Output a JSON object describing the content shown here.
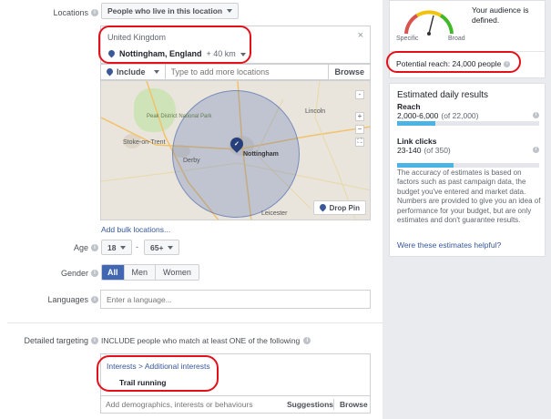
{
  "locations": {
    "label": "Locations",
    "type_dropdown": "People who live in this location",
    "country": "United Kingdom",
    "city": "Nottingham, England",
    "radius": "+ 40 km",
    "include_dropdown": "Include",
    "add_placeholder": "Type to add more locations",
    "browse_label": "Browse",
    "add_bulk_link": "Add bulk locations...",
    "map": {
      "place_labels": [
        "Peak District National Park",
        "Stoke-on-Trent",
        "Derby",
        "Nottingham",
        "Lincoln",
        "Leicester"
      ],
      "drop_pin_label": "Drop Pin",
      "zoom_in": "+",
      "zoom_out": "−"
    }
  },
  "age": {
    "label": "Age",
    "min": "18",
    "separator": "-",
    "max": "65+"
  },
  "gender": {
    "label": "Gender",
    "options": [
      "All",
      "Men",
      "Women"
    ],
    "selected": "All"
  },
  "languages": {
    "label": "Languages",
    "placeholder": "Enter a language..."
  },
  "detailed_targeting": {
    "label": "Detailed targeting",
    "description": "INCLUDE people who match at least ONE of the following",
    "breadcrumb": "Interests > Additional interests",
    "item": "Trail running",
    "add_placeholder": "Add demographics, interests or behaviours",
    "suggestions_label": "Suggestions",
    "browse_label": "Browse"
  },
  "audience_card": {
    "defined_text": "Your audience is defined.",
    "specific_label": "Specific",
    "broad_label": "Broad",
    "potential_reach": "Potential reach: 24,000 people"
  },
  "estimates": {
    "title": "Estimated daily results",
    "reach_label": "Reach",
    "reach_value": "2,000-6,000",
    "reach_total": "(of 22,000)",
    "reach_fraction": 0.27,
    "clicks_label": "Link clicks",
    "clicks_value": "23-140",
    "clicks_total": "(of 350)",
    "clicks_fraction": 0.4,
    "disclaimer": "The accuracy of estimates is based on factors such as past campaign data, the budget you've entered and market data. Numbers are provided to give you an idea of performance for your budget, but are only estimates and don't guarantee results.",
    "feedback_link": "Were these estimates helpful?"
  },
  "colors": {
    "accent": "#4267b2",
    "highlight_ring": "#e3101a",
    "bar_fill": "#4cb3e5",
    "link": "#365899"
  },
  "icons": [
    "info-icon",
    "pin-icon",
    "caret-down-icon",
    "close-icon",
    "zoom-in-icon",
    "zoom-out-icon",
    "fullscreen-icon"
  ]
}
